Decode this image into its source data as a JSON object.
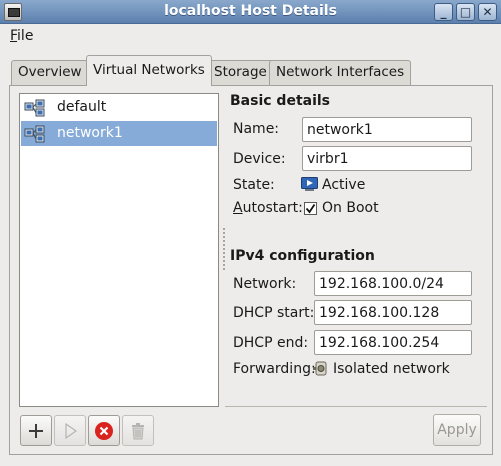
{
  "window": {
    "title": "localhost Host Details"
  },
  "titlebar_buttons": {
    "minimize": "_",
    "maximize": "□",
    "close": "✕"
  },
  "menubar": {
    "file_prefix": "",
    "file_accel": "F",
    "file_rest": "ile"
  },
  "tabs": [
    {
      "label": "Overview",
      "active": false
    },
    {
      "label": "Virtual Networks",
      "active": true
    },
    {
      "label": "Storage",
      "active": false
    },
    {
      "label": "Network Interfaces",
      "active": false
    }
  ],
  "networks": [
    {
      "name": "default",
      "selected": false
    },
    {
      "name": "network1",
      "selected": true
    }
  ],
  "basic": {
    "title": "Basic details",
    "name_label": "Name:",
    "name_value": "network1",
    "device_label": "Device:",
    "device_value": "virbr1",
    "state_label": "State:",
    "state_value": "Active",
    "autostart_accel": "A",
    "autostart_rest": "utostart:",
    "autostart_value": "On Boot",
    "autostart_checked": true
  },
  "ipv4": {
    "title": "IPv4 configuration",
    "network_label": "Network:",
    "network_value": "192.168.100.0/24",
    "dhcp_start_label": "DHCP start:",
    "dhcp_start_value": "192.168.100.128",
    "dhcp_end_label": "DHCP end:",
    "dhcp_end_value": "192.168.100.254",
    "forwarding_label": "Forwarding:",
    "forwarding_value": "Isolated network"
  },
  "toolbar": {
    "add_icon": "plus-icon",
    "start_icon": "play-icon",
    "stop_icon": "stop-icon",
    "delete_icon": "trash-icon"
  },
  "apply": {
    "label": "Apply",
    "enabled": false
  },
  "colors": {
    "titlebar": "#5c80ad",
    "selection": "#86abd9",
    "stop_red": "#d8231e"
  }
}
